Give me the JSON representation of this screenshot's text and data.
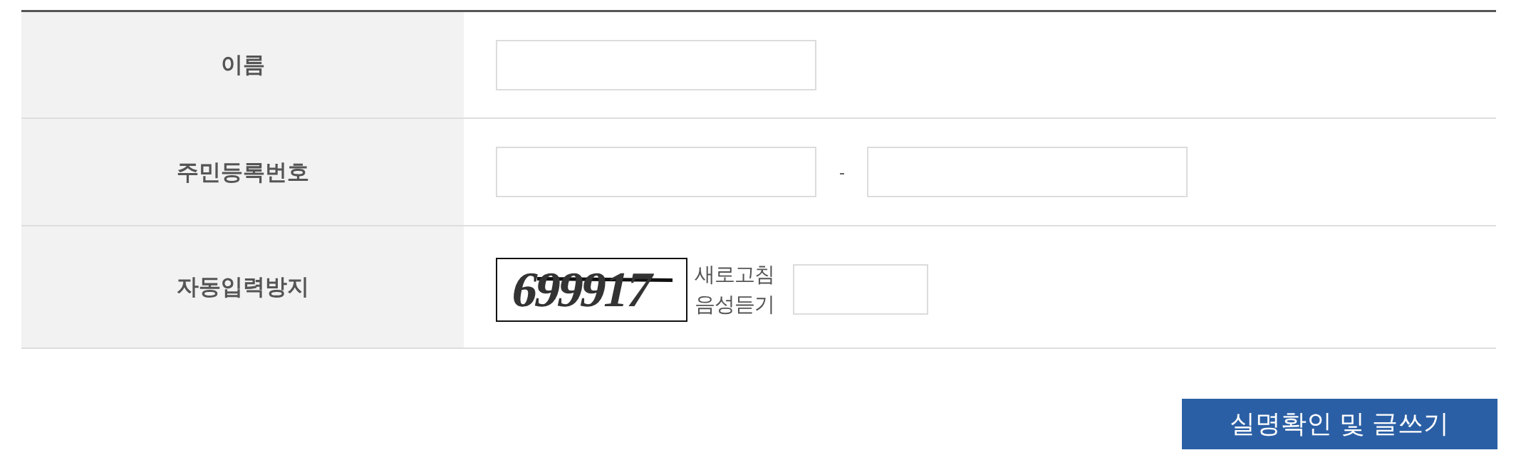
{
  "form": {
    "rows": [
      {
        "kind": "single",
        "label": "이름"
      },
      {
        "kind": "split",
        "label": "주민등록번호",
        "separator": "-"
      },
      {
        "kind": "captcha",
        "label": "자동입력방지",
        "captcha_text": "699917",
        "links": [
          "새로고침",
          "음성듣기"
        ]
      }
    ]
  },
  "submit_button": "실명확인 및 글쓰기"
}
